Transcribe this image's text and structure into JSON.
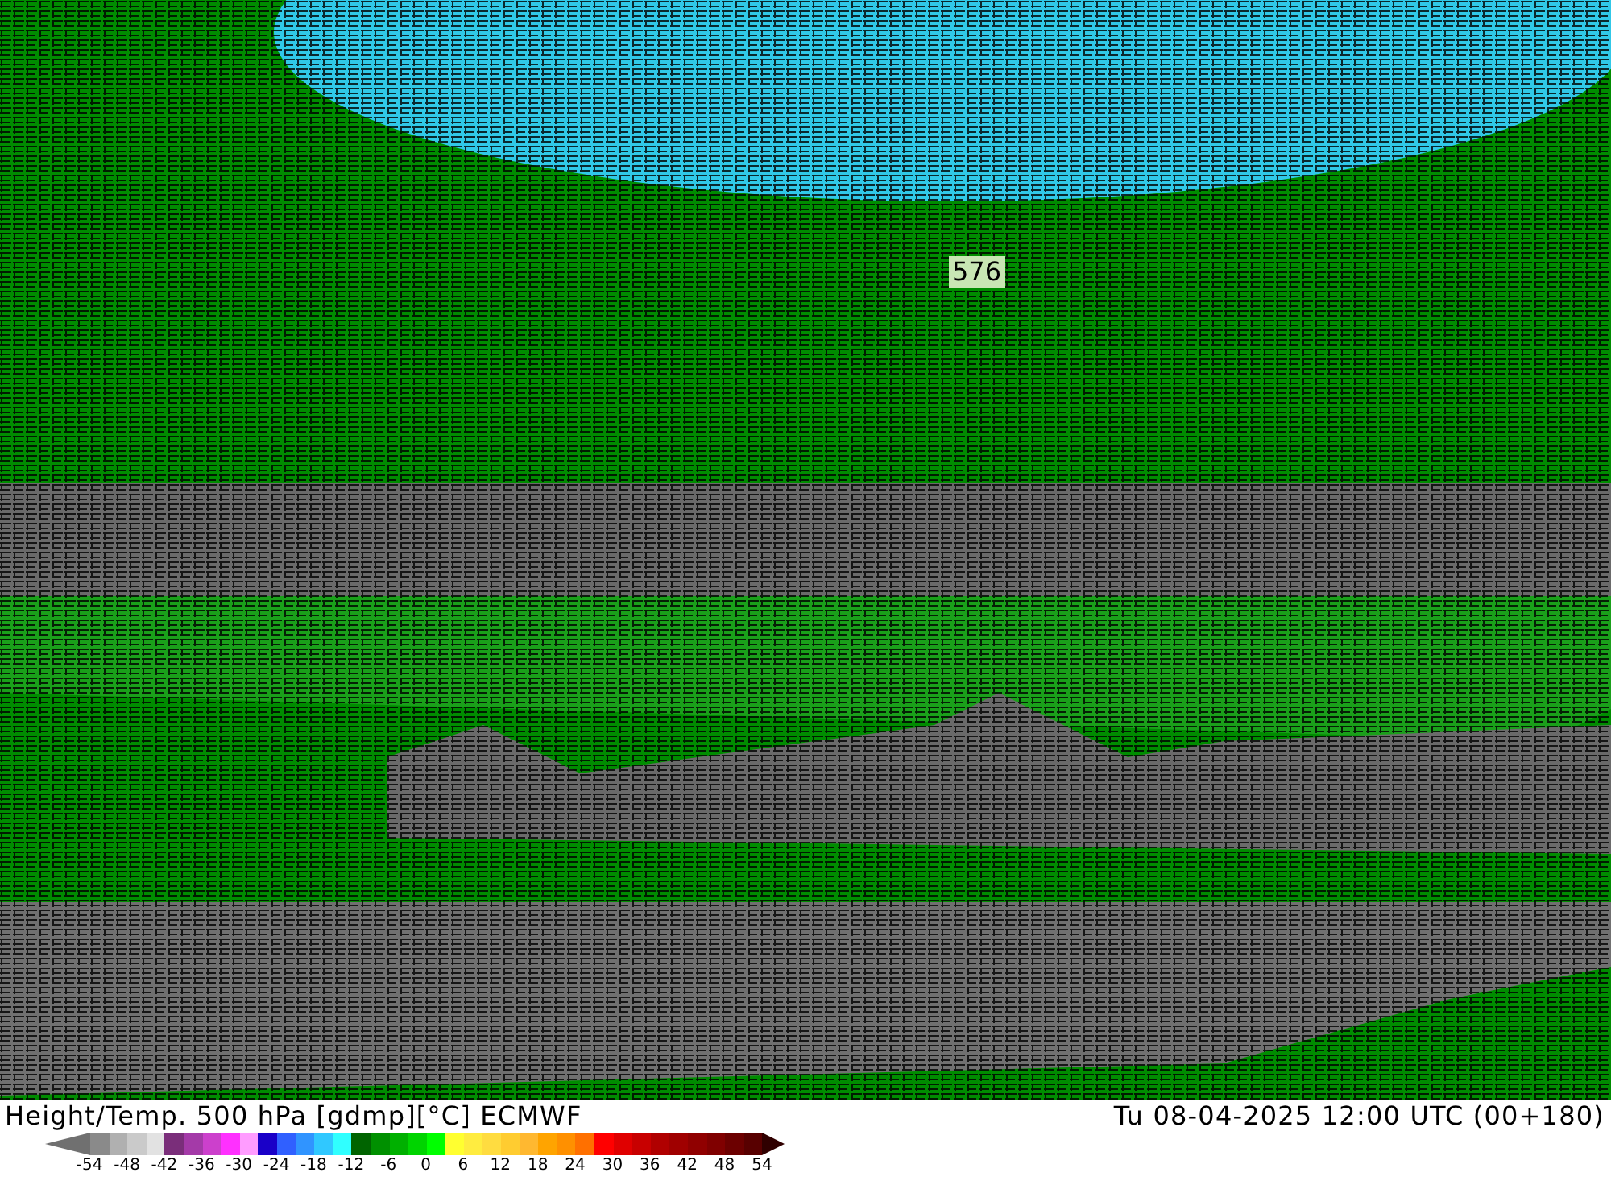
{
  "map": {
    "contour_label": "576"
  },
  "footer": {
    "title": "Height/Temp. 500 hPa [gdmp][°C] ECMWF",
    "valid_time": "Tu 08-04-2025 12:00 UTC (00+180)"
  },
  "legend": {
    "swatches": [
      {
        "color": "#8a8a8a"
      },
      {
        "color": "#b0b0b0"
      },
      {
        "color": "#cacaca"
      },
      {
        "color": "#e2e2e2"
      },
      {
        "color": "#7a2e7a"
      },
      {
        "color": "#a43aa8"
      },
      {
        "color": "#cc40cc"
      },
      {
        "color": "#ff30ff"
      },
      {
        "color": "#ff9cff"
      },
      {
        "color": "#1a00c8"
      },
      {
        "color": "#3060ff"
      },
      {
        "color": "#3094ff"
      },
      {
        "color": "#30c8ff"
      },
      {
        "color": "#30ffff"
      },
      {
        "color": "#006400"
      },
      {
        "color": "#009000"
      },
      {
        "color": "#00b000"
      },
      {
        "color": "#00d400"
      },
      {
        "color": "#00ff00"
      },
      {
        "color": "#ffff30"
      },
      {
        "color": "#ffec40"
      },
      {
        "color": "#ffdc40"
      },
      {
        "color": "#ffcc30"
      },
      {
        "color": "#ffb830"
      },
      {
        "color": "#ffa400"
      },
      {
        "color": "#ff9000"
      },
      {
        "color": "#ff7000"
      },
      {
        "color": "#ff0000"
      },
      {
        "color": "#e00000"
      },
      {
        "color": "#c80000"
      },
      {
        "color": "#b00000"
      },
      {
        "color": "#a00000"
      },
      {
        "color": "#900000"
      },
      {
        "color": "#800000"
      },
      {
        "color": "#6c0000"
      },
      {
        "color": "#580000"
      }
    ],
    "ticks": [
      "-54",
      "-48",
      "-42",
      "-36",
      "-30",
      "-24",
      "-18",
      "-12",
      "-6",
      "0",
      "6",
      "12",
      "18",
      "24",
      "30",
      "36",
      "42",
      "48",
      "54"
    ]
  }
}
